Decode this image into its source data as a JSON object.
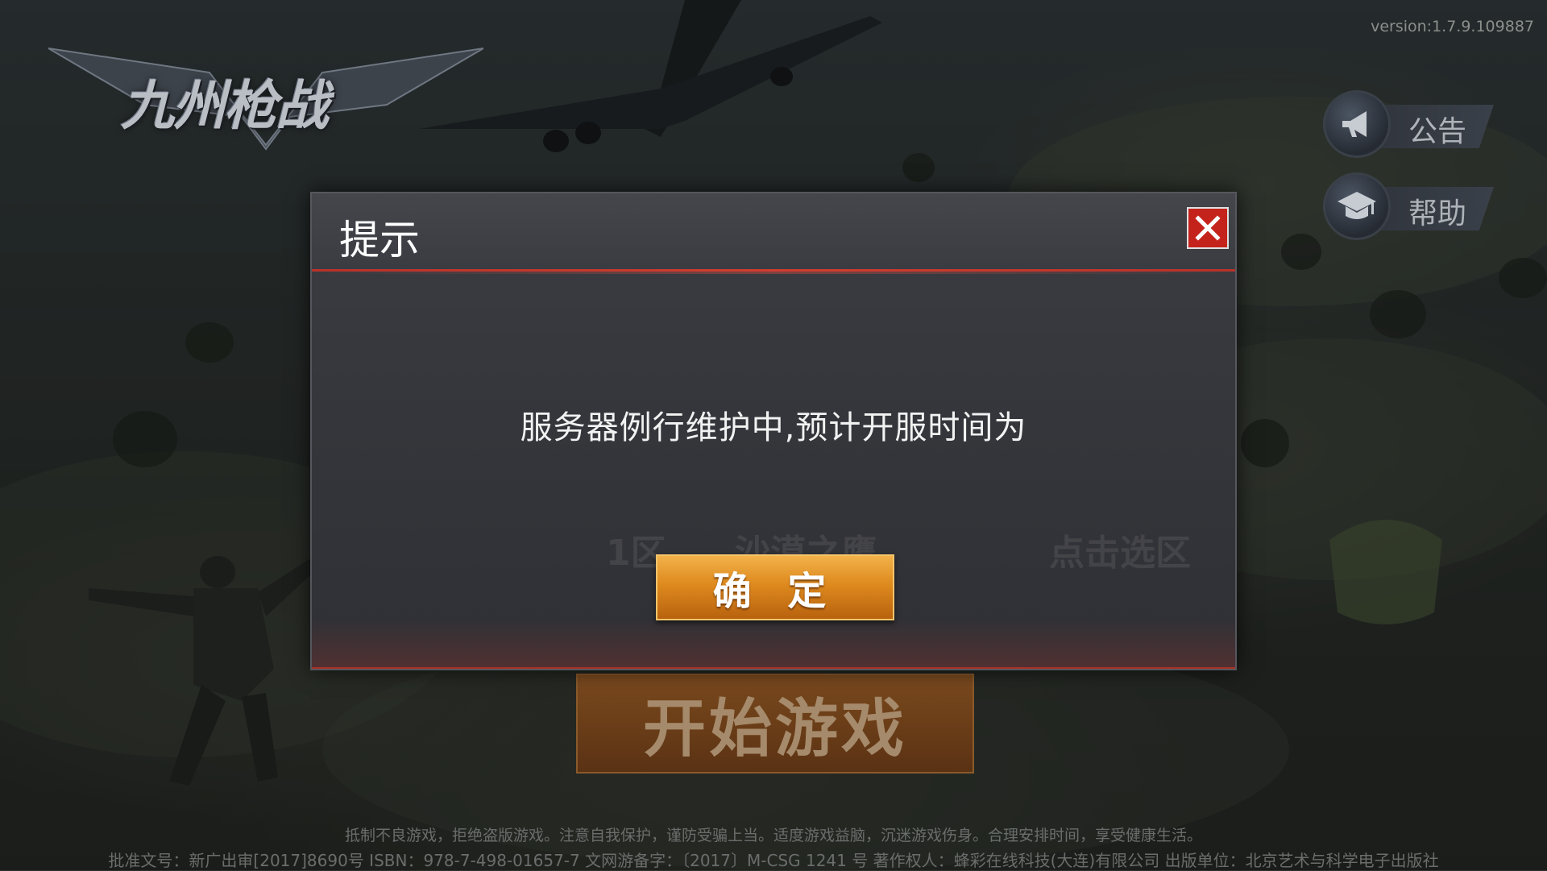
{
  "version": "version:1.7.9.109887",
  "logo_text": "九州枪战",
  "side_buttons": [
    {
      "label": "公告",
      "icon": "megaphone-icon"
    },
    {
      "label": "帮助",
      "icon": "graduation-cap-icon"
    }
  ],
  "start_button": "开始游戏",
  "dialog": {
    "title": "提示",
    "message": "服务器例行维护中,预计开服时间为",
    "confirm": "确 定",
    "background_hints": [
      "1区",
      "沙漠之鹰",
      "点击选区"
    ]
  },
  "footer": {
    "line1": "抵制不良游戏，拒绝盗版游戏。注意自我保护，谨防受骗上当。适度游戏益脑，沉迷游戏伤身。合理安排时间，享受健康生活。",
    "line2": "批准文号：新广出审[2017]8690号    ISBN：978-7-498-01657-7    文网游备字：〔2017〕M-CSG 1241 号    著作权人：蜂彩在线科技(大连)有限公司    出版单位：北京艺术与科学电子出版社"
  },
  "colors": {
    "accent_red": "#c4231b",
    "confirm_orange": "#de8a1e",
    "start_orange": "#6b3e18"
  }
}
